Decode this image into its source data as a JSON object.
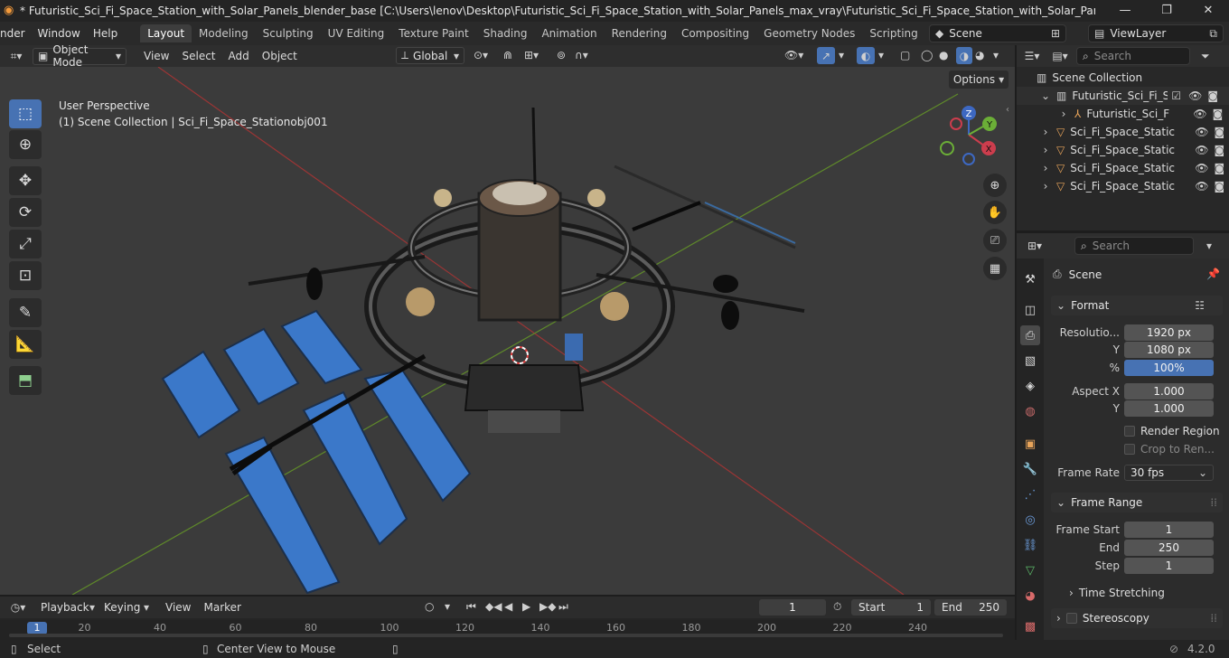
{
  "window": {
    "title": "* Futuristic_Sci_Fi_Space_Station_with_Solar_Panels_blender_base [C:\\Users\\lenov\\Desktop\\Futuristic_Sci_Fi_Space_Station_with_Solar_Panels_max_vray\\Futuristic_Sci_Fi_Space_Station_with_Solar_Panels_blender_base.blend] - B...",
    "minimize": "—",
    "maximize": "❐",
    "close": "✕"
  },
  "menus": [
    "nder",
    "Window",
    "Help"
  ],
  "workspaces": [
    "Layout",
    "Modeling",
    "Sculpting",
    "UV Editing",
    "Texture Paint",
    "Shading",
    "Animation",
    "Rendering",
    "Compositing",
    "Geometry Nodes",
    "Scripting"
  ],
  "scene_field": "Scene",
  "viewlayer_field": "ViewLayer",
  "viewport": {
    "mode": "Object Mode",
    "menus": [
      "View",
      "Select",
      "Add",
      "Object"
    ],
    "orientation": "Global",
    "options": "Options",
    "perspective": "User Perspective",
    "collection_info": "(1) Scene Collection | Sci_Fi_Space_Stationobj001",
    "gizmo": {
      "z": "Z",
      "y": "Y",
      "x": "X"
    }
  },
  "outliner": {
    "search_placeholder": "Search",
    "root": "Scene Collection",
    "collection": "Futuristic_Sci_Fi_S",
    "child": "Futuristic_Sci_F",
    "objects": [
      "Sci_Fi_Space_Static",
      "Sci_Fi_Space_Static",
      "Sci_Fi_Space_Static",
      "Sci_Fi_Space_Static"
    ]
  },
  "properties": {
    "search_placeholder": "Search",
    "context": "Scene",
    "format": {
      "header": "Format",
      "res_label": "Resolutio...",
      "res_x": "1920 px",
      "y_label": "Y",
      "res_y": "1080 px",
      "pct_label": "%",
      "pct": "100%",
      "aspect_label": "Aspect X",
      "aspect_x": "1.000",
      "aspect_y_label": "Y",
      "aspect_y": "1.000",
      "render_region": "Render Region",
      "crop": "Crop to Ren...",
      "frame_rate_label": "Frame Rate",
      "frame_rate": "30 fps"
    },
    "frame_range": {
      "header": "Frame Range",
      "start_label": "Frame Start",
      "start": "1",
      "end_label": "End",
      "end": "250",
      "step_label": "Step",
      "step": "1"
    },
    "time_stretching": "Time Stretching",
    "stereoscopy": "Stereoscopy"
  },
  "timeline": {
    "menus": [
      "Playback",
      "Keying",
      "View",
      "Marker"
    ],
    "current_frame": "1",
    "start_label": "Start",
    "start": "1",
    "end_label": "End",
    "end": "250",
    "ruler": [
      "1",
      "20",
      "40",
      "60",
      "80",
      "100",
      "120",
      "140",
      "160",
      "180",
      "200",
      "220",
      "240"
    ]
  },
  "status": {
    "select": "Select",
    "center_view": "Center View to Mouse",
    "version": "4.2.0"
  }
}
